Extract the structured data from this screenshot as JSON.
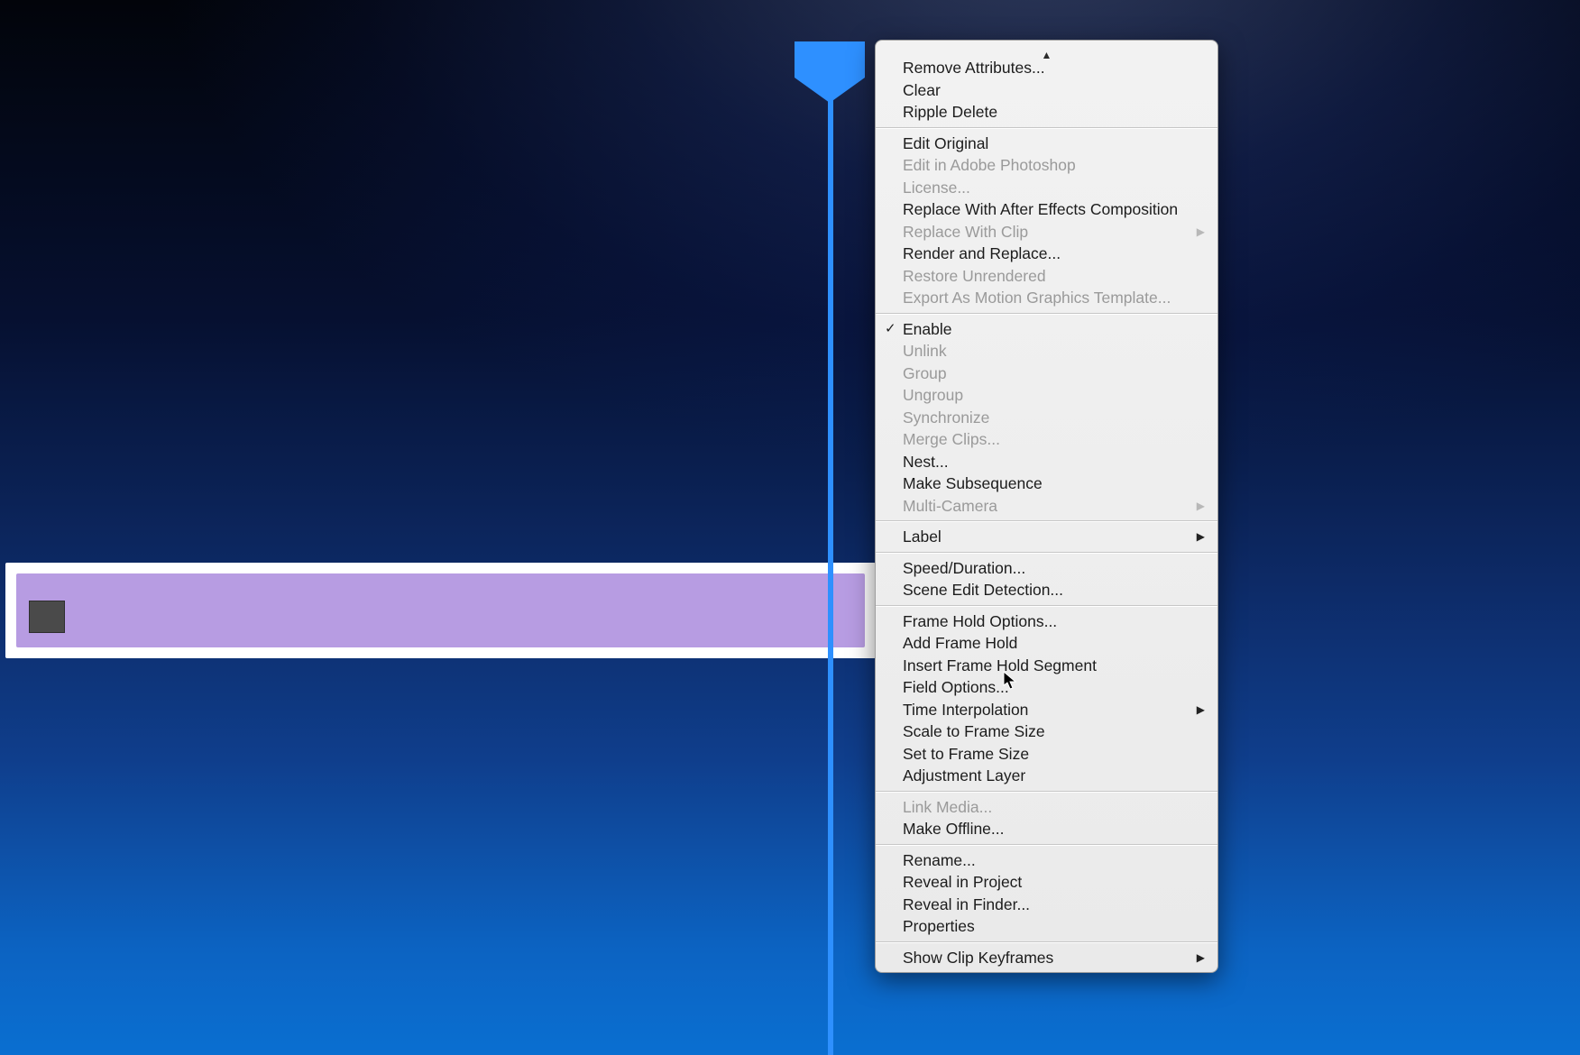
{
  "timeline": {
    "clip_color": "#b79ce2",
    "track_bg": "#ffffff",
    "playhead_color": "#2e90ff"
  },
  "menu": {
    "groups": [
      {
        "items": [
          {
            "id": "remove-attributes",
            "label": "Remove Attributes...",
            "enabled": true
          },
          {
            "id": "clear",
            "label": "Clear",
            "enabled": true
          },
          {
            "id": "ripple-delete",
            "label": "Ripple Delete",
            "enabled": true
          }
        ]
      },
      {
        "items": [
          {
            "id": "edit-original",
            "label": "Edit Original",
            "enabled": true
          },
          {
            "id": "edit-in-photoshop",
            "label": "Edit in Adobe Photoshop",
            "enabled": false
          },
          {
            "id": "license",
            "label": "License...",
            "enabled": false
          },
          {
            "id": "replace-ae",
            "label": "Replace With After Effects Composition",
            "enabled": true
          },
          {
            "id": "replace-clip",
            "label": "Replace With Clip",
            "enabled": false,
            "submenu": true
          },
          {
            "id": "render-replace",
            "label": "Render and Replace...",
            "enabled": true
          },
          {
            "id": "restore-unrendered",
            "label": "Restore Unrendered",
            "enabled": false
          },
          {
            "id": "export-mogrt",
            "label": "Export As Motion Graphics Template...",
            "enabled": false
          }
        ]
      },
      {
        "items": [
          {
            "id": "enable",
            "label": "Enable",
            "enabled": true,
            "checked": true
          },
          {
            "id": "unlink",
            "label": "Unlink",
            "enabled": false
          },
          {
            "id": "group",
            "label": "Group",
            "enabled": false
          },
          {
            "id": "ungroup",
            "label": "Ungroup",
            "enabled": false
          },
          {
            "id": "synchronize",
            "label": "Synchronize",
            "enabled": false
          },
          {
            "id": "merge-clips",
            "label": "Merge Clips...",
            "enabled": false
          },
          {
            "id": "nest",
            "label": "Nest...",
            "enabled": true
          },
          {
            "id": "make-subseq",
            "label": "Make Subsequence",
            "enabled": true
          },
          {
            "id": "multi-camera",
            "label": "Multi-Camera",
            "enabled": false,
            "submenu": true
          }
        ]
      },
      {
        "items": [
          {
            "id": "label",
            "label": "Label",
            "enabled": true,
            "submenu": true
          }
        ]
      },
      {
        "items": [
          {
            "id": "speed-duration",
            "label": "Speed/Duration...",
            "enabled": true
          },
          {
            "id": "scene-edit-detect",
            "label": "Scene Edit Detection...",
            "enabled": true
          }
        ]
      },
      {
        "items": [
          {
            "id": "frame-hold-options",
            "label": "Frame Hold Options...",
            "enabled": true
          },
          {
            "id": "add-frame-hold",
            "label": "Add Frame Hold",
            "enabled": true
          },
          {
            "id": "insert-frame-hold-seg",
            "label": "Insert Frame Hold Segment",
            "enabled": true
          },
          {
            "id": "field-options",
            "label": "Field Options...",
            "enabled": true
          },
          {
            "id": "time-interpolation",
            "label": "Time Interpolation",
            "enabled": true,
            "submenu": true
          },
          {
            "id": "scale-to-frame",
            "label": "Scale to Frame Size",
            "enabled": true
          },
          {
            "id": "set-to-frame",
            "label": "Set to Frame Size",
            "enabled": true
          },
          {
            "id": "adjustment-layer",
            "label": "Adjustment Layer",
            "enabled": true
          }
        ]
      },
      {
        "items": [
          {
            "id": "link-media",
            "label": "Link Media...",
            "enabled": false
          },
          {
            "id": "make-offline",
            "label": "Make Offline...",
            "enabled": true
          }
        ]
      },
      {
        "items": [
          {
            "id": "rename",
            "label": "Rename...",
            "enabled": true
          },
          {
            "id": "reveal-project",
            "label": "Reveal in Project",
            "enabled": true
          },
          {
            "id": "reveal-finder",
            "label": "Reveal in Finder...",
            "enabled": true
          },
          {
            "id": "properties",
            "label": "Properties",
            "enabled": true
          }
        ]
      },
      {
        "items": [
          {
            "id": "show-clip-keyframes",
            "label": "Show Clip Keyframes",
            "enabled": true,
            "submenu": true
          }
        ]
      }
    ]
  }
}
